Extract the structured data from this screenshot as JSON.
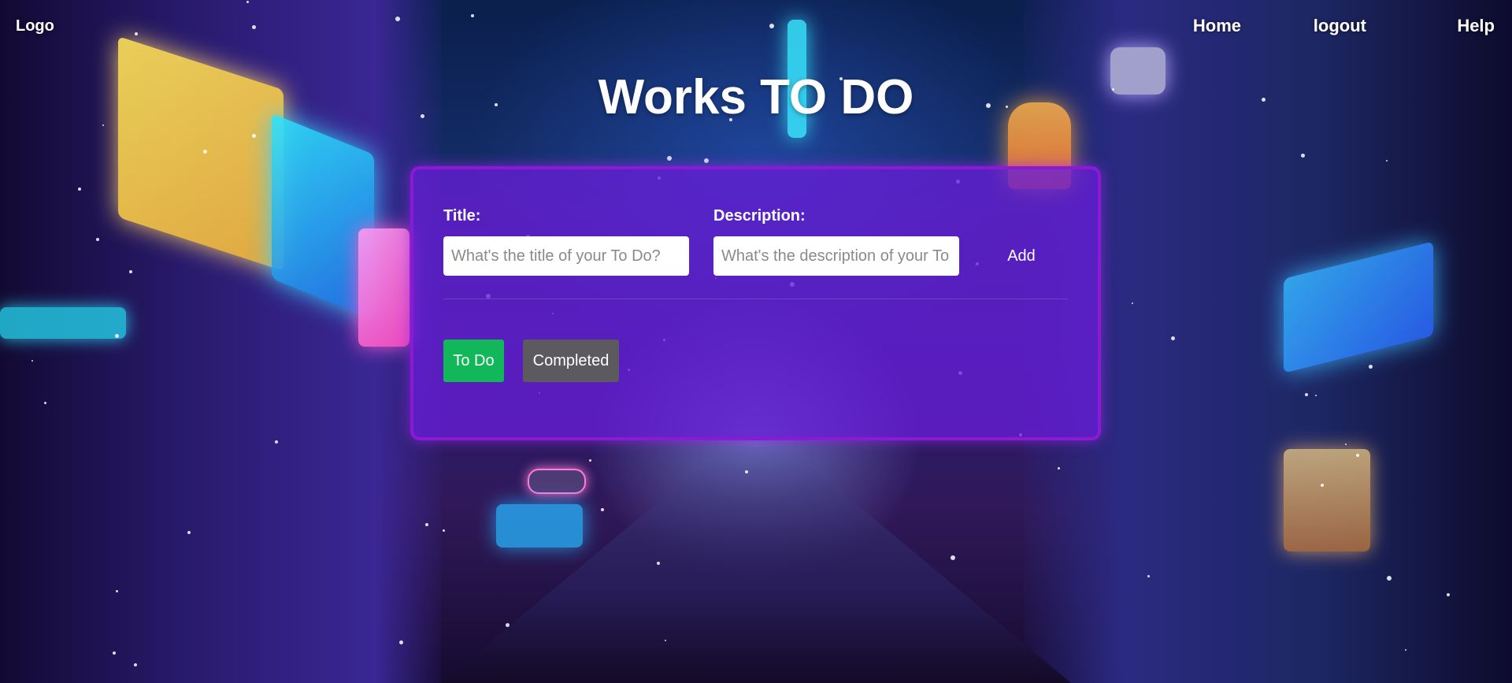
{
  "nav": {
    "logo": "Logo",
    "links": {
      "home": "Home",
      "logout": "logout",
      "help": "Help"
    }
  },
  "page": {
    "title": "Works TO DO"
  },
  "form": {
    "title_label": "Title:",
    "title_placeholder": "What's the title of your To Do?",
    "title_value": "",
    "description_label": "Description:",
    "description_placeholder": "What's the description of your To Do?",
    "description_value": "",
    "add_label": "Add"
  },
  "tabs": {
    "todo": "To Do",
    "completed": "Completed"
  },
  "colors": {
    "card_bg": "#671ed6",
    "card_border": "#8d18d6",
    "todo_button": "#12b75a",
    "completed_button": "#5d5a5f"
  }
}
